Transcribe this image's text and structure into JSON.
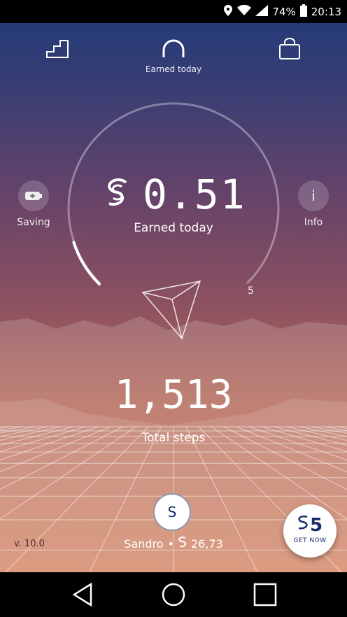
{
  "status_bar": {
    "battery_percent": "74%",
    "time": "20:13",
    "icons": [
      "location-pin-icon",
      "wifi-icon",
      "signal-icon",
      "battery-icon"
    ]
  },
  "top_nav": {
    "items": [
      {
        "icon": "stairs-icon"
      },
      {
        "icon": "headphones-icon",
        "label": "Earned today"
      },
      {
        "icon": "shopping-bag-icon"
      }
    ]
  },
  "side": {
    "left_label": "Saving",
    "right_label": "Info",
    "right_glyph": "i"
  },
  "gauge": {
    "value": "0.51",
    "label": "Earned today",
    "max_label": "5",
    "fill_fraction": 0.1
  },
  "steps": {
    "value": "1,513",
    "label": "Total steps"
  },
  "user": {
    "avatar_initial": "S",
    "name": "Sandro",
    "separator": "•",
    "balance": "26,73"
  },
  "version": "v. 10.0",
  "get_now": {
    "value": "5",
    "label": "GET NOW"
  },
  "colors": {
    "top": "#1d3a78",
    "bottom": "#cf7a55",
    "accent_dark": "#1b2a6a"
  }
}
